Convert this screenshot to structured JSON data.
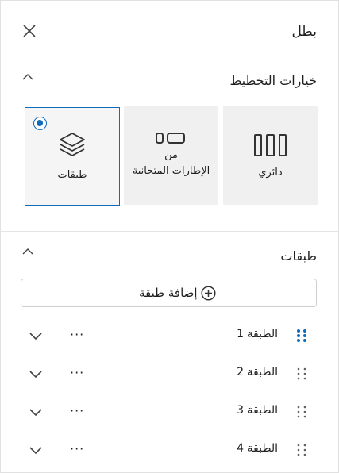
{
  "panel": {
    "title": "بطل",
    "close_icon": "close-icon"
  },
  "layout_section": {
    "title": "خيارات التخطيط",
    "options": [
      {
        "label": "دائري",
        "icon": "carousel-icon",
        "selected": false
      },
      {
        "label_line1": "من",
        "label_line2": "الإطارات المتجانبة",
        "icon": "tiles-icon",
        "selected": false
      },
      {
        "label": "طبقات",
        "icon": "layers-icon",
        "selected": true
      }
    ]
  },
  "layers_section": {
    "title": "طبقات",
    "add_label": "إضافة طبقة",
    "items": [
      {
        "label": "الطبقة 1",
        "grip_color": "#0f6cbd"
      },
      {
        "label": "الطبقة 2",
        "grip_color": "#616161"
      },
      {
        "label": "الطبقة 3",
        "grip_color": "#616161"
      },
      {
        "label": "الطبقة 4",
        "grip_color": "#616161"
      }
    ],
    "more_label": "···"
  },
  "colors": {
    "accent": "#0f6cbd",
    "card_bg": "#f0f0f0"
  }
}
